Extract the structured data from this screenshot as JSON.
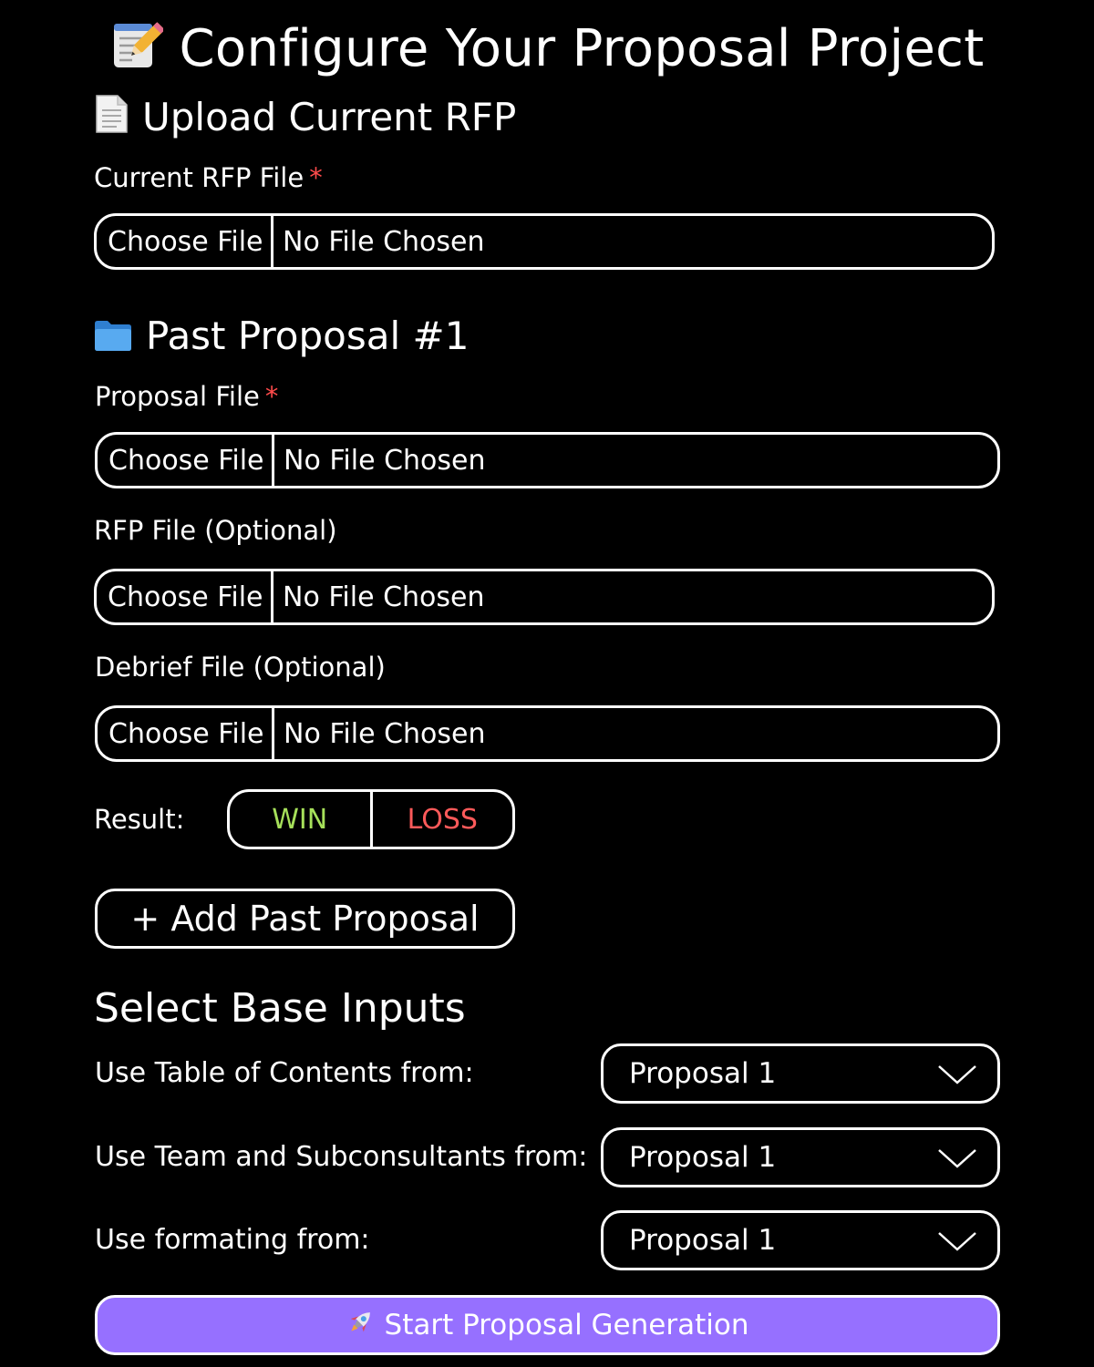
{
  "title": {
    "icon": "memo-icon",
    "text": "Configure Your Proposal Project"
  },
  "current_rfp": {
    "heading_icon": "page-icon",
    "heading": "Upload Current RFP",
    "label": "Current RFP File",
    "required_mark": "*",
    "button": "Choose File",
    "status": "No File Chosen"
  },
  "past_proposal": {
    "heading_icon": "folder-icon",
    "heading": "Past Proposal #1",
    "proposal_file": {
      "label": "Proposal File",
      "required_mark": "*",
      "button": "Choose File",
      "status": "No File Chosen"
    },
    "rfp_file": {
      "label": "RFP File (Optional)",
      "button": "Choose File",
      "status": "No File Chosen"
    },
    "debrief_file": {
      "label": "Debrief File (Optional)",
      "button": "Choose File",
      "status": "No File Chosen"
    },
    "result": {
      "label": "Result:",
      "win": "WIN",
      "loss": "LOSS",
      "win_color": "#a6e05a",
      "loss_color": "#ff5a5a"
    }
  },
  "add_past_proposal": "+ Add Past Proposal",
  "base_inputs": {
    "heading": "Select Base Inputs",
    "rows": [
      {
        "label": "Use Table of Contents from:",
        "value": "Proposal 1"
      },
      {
        "label": "Use Team and Subconsultants from:",
        "value": "Proposal 1"
      },
      {
        "label": "Use formating from:",
        "value": "Proposal 1"
      }
    ]
  },
  "start_button": {
    "icon": "rocket-icon",
    "label": "Start Proposal Generation",
    "color": "#9670ff"
  },
  "colors": {
    "background": "#000000",
    "foreground": "#ffffff",
    "required": "#ff4b4b"
  }
}
